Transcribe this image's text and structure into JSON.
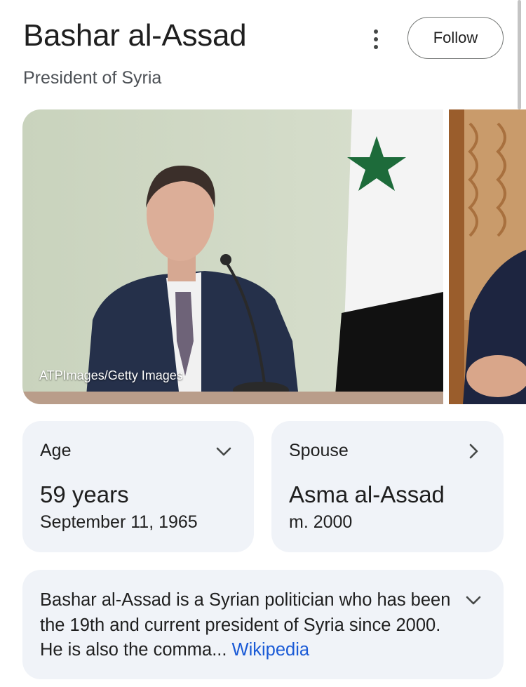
{
  "header": {
    "title": "Bashar al-Assad",
    "subtitle": "President of Syria",
    "follow_label": "Follow"
  },
  "images": {
    "credit": "ATPImages/Getty Images"
  },
  "cards": {
    "age": {
      "label": "Age",
      "value": "59 years",
      "sub": "September 11, 1965",
      "icon": "chevron-down-icon"
    },
    "spouse": {
      "label": "Spouse",
      "value": "Asma al-Assad",
      "sub": "m. 2000",
      "icon": "chevron-right-icon"
    }
  },
  "description": {
    "text": "Bashar al-Assad is a Syrian politician who has been the 19th and current president of Syria since 2000. He is also the comma",
    "ellipsis": "... ",
    "source_link": "Wikipedia"
  },
  "colors": {
    "card_bg": "#f0f3f8",
    "link": "#1a5ad6"
  }
}
